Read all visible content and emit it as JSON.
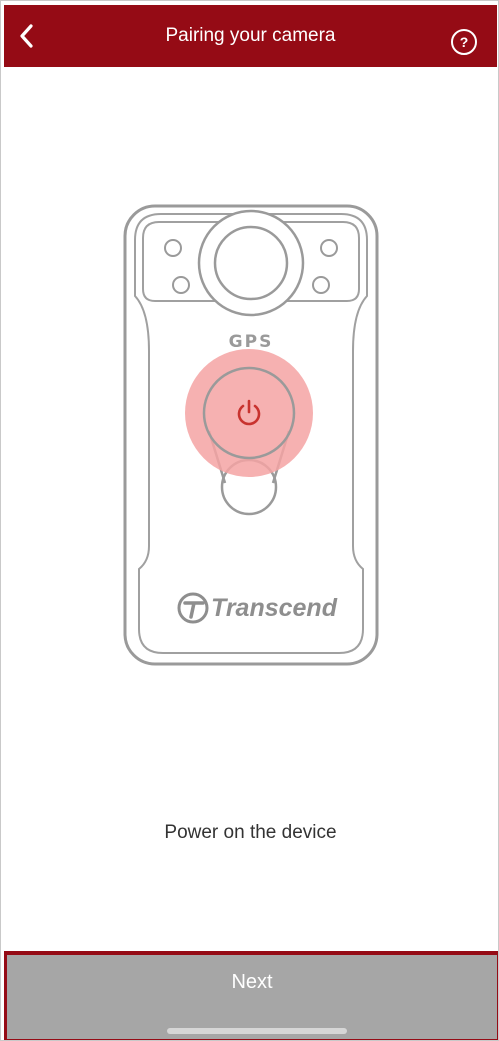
{
  "header": {
    "title": "Pairing your camera",
    "back_icon": "chevron-left-icon",
    "help_icon": "question-circle-icon",
    "help_symbol": "?",
    "background_color": "#950b15"
  },
  "illustration": {
    "device_label": "GPS",
    "brand": "Transcend",
    "highlight_color": "#f4a3a3",
    "power_icon": "power-icon"
  },
  "instruction": {
    "text": "Power on the device"
  },
  "footer": {
    "next_label": "Next",
    "button_color": "#a6a6a6"
  }
}
